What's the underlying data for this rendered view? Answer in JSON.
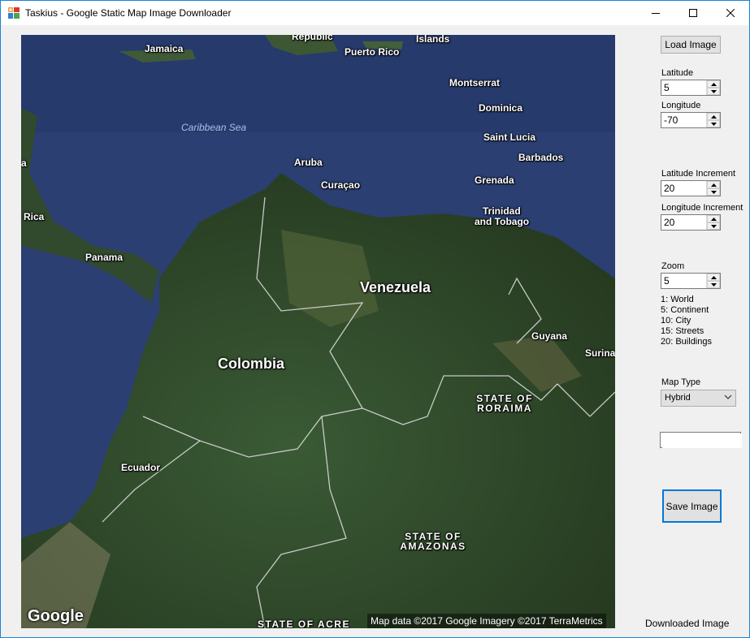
{
  "window": {
    "title": "Taskius - Google Static Map Image Downloader",
    "icons": [
      "app-icon",
      "minimize-icon",
      "maximize-icon",
      "close-icon"
    ]
  },
  "map": {
    "map_type_shown": "Hybrid",
    "labels": {
      "jamaica": "Jamaica",
      "republic": "Republic",
      "islands": "Islands",
      "puerto_rico": "Puerto Rico",
      "montserrat": "Montserrat",
      "dominica": "Dominica",
      "caribbean_sea": "Caribbean Sea",
      "saint_lucia": "Saint Lucia",
      "barbados": "Barbados",
      "aruba": "Aruba",
      "curacao": "Curaçao",
      "grenada": "Grenada",
      "trinidad_line1": "Trinidad",
      "trinidad_line2": "and Tobago",
      "partial_a": "a",
      "rica": "Rica",
      "panama": "Panama",
      "venezuela": "Venezuela",
      "guyana": "Guyana",
      "surina": "Surina",
      "colombia": "Colombia",
      "roraima_line1": "STATE OF",
      "roraima_line2": "RORAIMA",
      "ecuador": "Ecuador",
      "amazonas_line1": "STATE OF",
      "amazonas_line2": "AMAZONAS",
      "acre": "STATE OF ACRE"
    },
    "google_logo": "Google",
    "attribution": "Map data ©2017 Google  Imagery ©2017 TerraMetrics"
  },
  "controls": {
    "load_button": "Load Image",
    "latitude_label": "Latitude",
    "latitude_value": "5",
    "longitude_label": "Longitude",
    "longitude_value": "-70",
    "lat_increment_label": "Latitude Increment",
    "lat_increment_value": "20",
    "lon_increment_label": "Longitude Increment",
    "lon_increment_value": "20",
    "zoom_label": "Zoom",
    "zoom_value": "5",
    "zoom_legend": [
      "1: World",
      "5: Continent",
      "10: City",
      "15: Streets",
      "20: Buildings"
    ],
    "map_type_label": "Map Type",
    "map_type_value": "Hybrid",
    "text_field_value": "",
    "save_button": "Save Image",
    "status_text": "Downloaded Image"
  },
  "colors": {
    "accent": "#0078d7",
    "window_border": "#1883d7",
    "ocean": "#2a3d70",
    "land": "#2f4a2c"
  }
}
